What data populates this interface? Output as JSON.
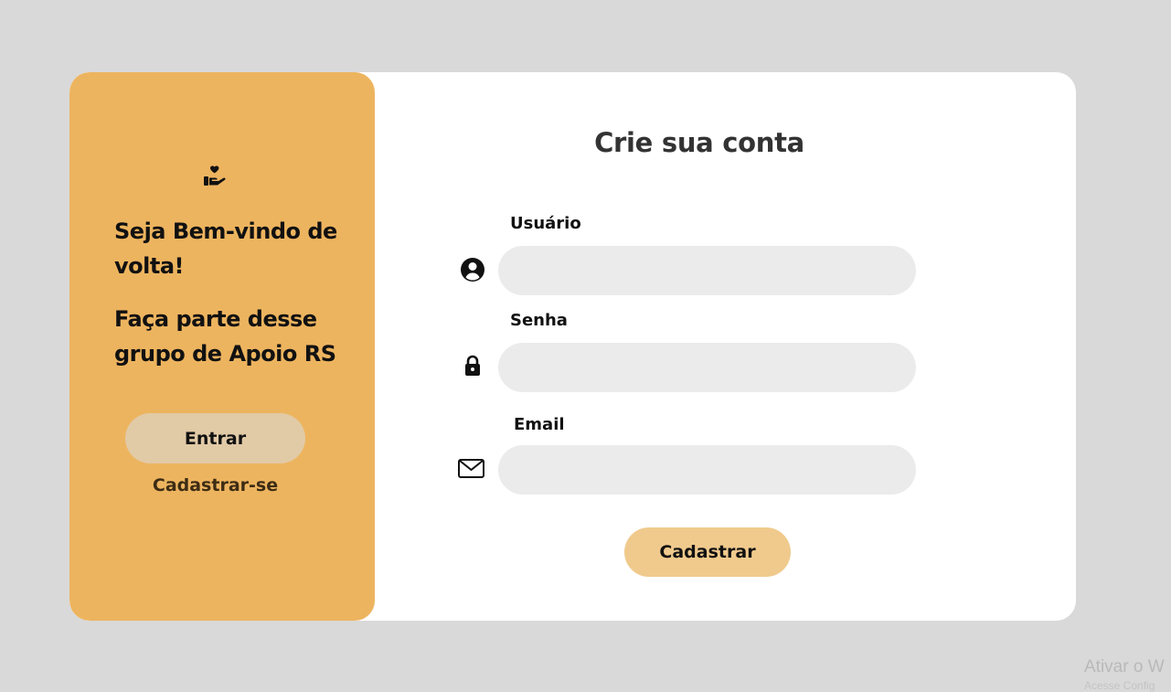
{
  "side_panel": {
    "icon": "hand-holding-heart-icon",
    "welcome_text": "Seja Bem-vindo de volta!",
    "tagline": "Faça parte desse grupo de Apoio RS",
    "enter_label": "Entrar",
    "register_link": "Cadastrar-se",
    "background": "#edb45f"
  },
  "form": {
    "title": "Crie sua conta",
    "fields": [
      {
        "label": "Usuário",
        "icon": "user-circle-icon",
        "value": ""
      },
      {
        "label": "Senha",
        "icon": "lock-icon",
        "value": ""
      },
      {
        "label": "Email",
        "icon": "envelope-icon",
        "value": ""
      }
    ],
    "submit_label": "Cadastrar",
    "submit_color": "#f0ca8d"
  },
  "os_watermark": {
    "title": "Ativar o W",
    "subtitle": "Acesse Config"
  }
}
